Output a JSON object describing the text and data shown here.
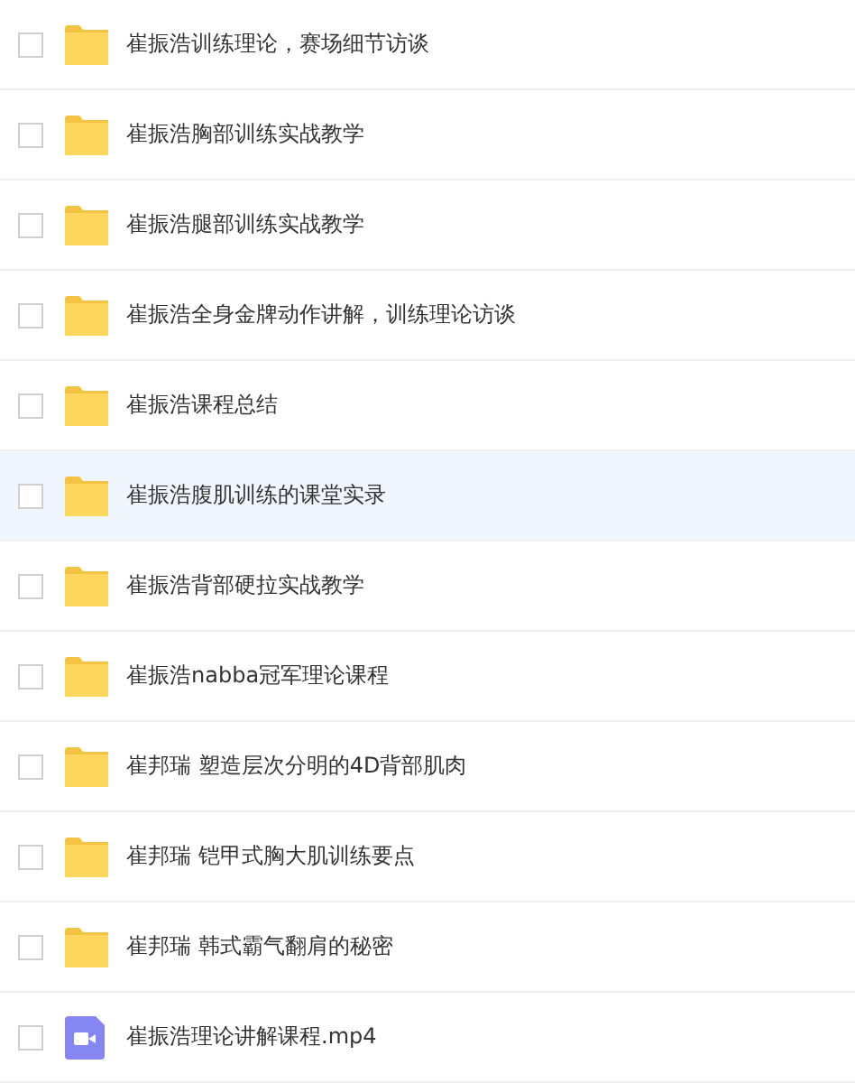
{
  "files": [
    {
      "kind": "folder",
      "name": "崔振浩训练理论，赛场细节访谈",
      "checked": false,
      "selected": false
    },
    {
      "kind": "folder",
      "name": "崔振浩胸部训练实战教学",
      "checked": false,
      "selected": false
    },
    {
      "kind": "folder",
      "name": "崔振浩腿部训练实战教学",
      "checked": false,
      "selected": false
    },
    {
      "kind": "folder",
      "name": "崔振浩全身金牌动作讲解，训练理论访谈",
      "checked": false,
      "selected": false
    },
    {
      "kind": "folder",
      "name": "崔振浩课程总结",
      "checked": false,
      "selected": false
    },
    {
      "kind": "folder",
      "name": "崔振浩腹肌训练的课堂实录",
      "checked": false,
      "selected": true
    },
    {
      "kind": "folder",
      "name": "崔振浩背部硬拉实战教学",
      "checked": false,
      "selected": false
    },
    {
      "kind": "folder",
      "name": "崔振浩nabba冠军理论课程",
      "checked": false,
      "selected": false
    },
    {
      "kind": "folder",
      "name": "崔邦瑞 塑造层次分明的4D背部肌肉",
      "checked": false,
      "selected": false
    },
    {
      "kind": "folder",
      "name": "崔邦瑞 铠甲式胸大肌训练要点",
      "checked": false,
      "selected": false
    },
    {
      "kind": "folder",
      "name": "崔邦瑞 韩式霸气翻肩的秘密",
      "checked": false,
      "selected": false
    },
    {
      "kind": "video",
      "name": "崔振浩理论讲解课程.mp4",
      "checked": false,
      "selected": false
    }
  ]
}
